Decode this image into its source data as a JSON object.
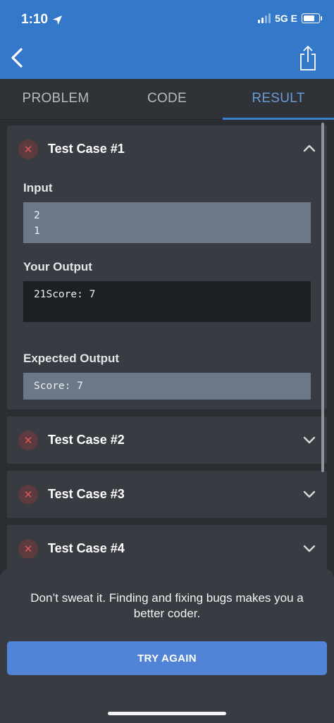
{
  "status_bar": {
    "time": "1:10",
    "network": "5G E"
  },
  "tabs": [
    {
      "label": "PROBLEM"
    },
    {
      "label": "CODE"
    },
    {
      "label": "RESULT"
    }
  ],
  "test_cases": [
    {
      "title": "Test Case #1",
      "expanded": true,
      "input_label": "Input",
      "input_value": "2\n1",
      "your_output_label": "Your Output",
      "your_output_value": "21Score: 7",
      "expected_output_label": "Expected Output",
      "expected_output_value": "Score: 7"
    },
    {
      "title": "Test Case #2",
      "expanded": false
    },
    {
      "title": "Test Case #3",
      "expanded": false
    },
    {
      "title": "Test Case #4",
      "expanded": false
    }
  ],
  "sheet": {
    "message": "Don’t sweat it. Finding and fixing bugs makes you a better coder.",
    "button_label": "TRY AGAIN"
  },
  "colors": {
    "header": "#3479c9",
    "active_tab": "#6a9ad7",
    "fail": "#e0565b",
    "button": "#5184d6"
  }
}
